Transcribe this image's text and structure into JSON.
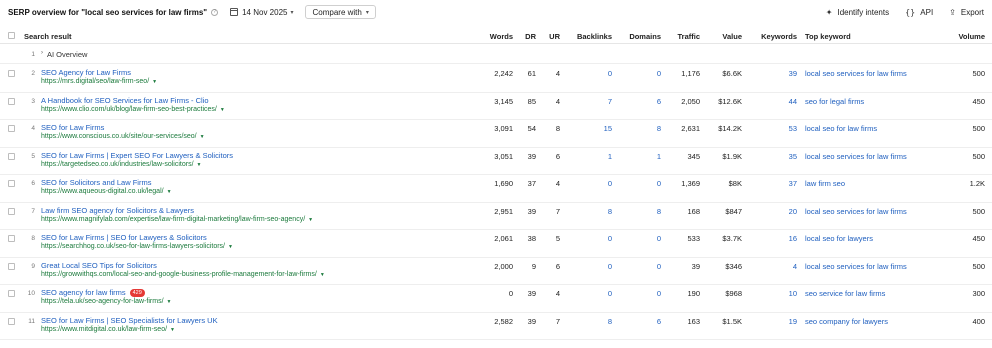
{
  "header": {
    "title": "SERP overview for \"local seo services for law firms\"",
    "date": "14 Nov 2025",
    "compare_label": "Compare with",
    "actions": [
      {
        "label": "Identify intents",
        "icon": "sparkle-icon"
      },
      {
        "label": "API",
        "icon": "braces-icon"
      },
      {
        "label": "Export",
        "icon": "export-icon"
      }
    ]
  },
  "table": {
    "columns": {
      "search_result": "Search result",
      "words": "Words",
      "dr": "DR",
      "ur": "UR",
      "backlinks": "Backlinks",
      "domains": "Domains",
      "traffic": "Traffic",
      "value": "Value",
      "keywords": "Keywords",
      "top_keyword": "Top keyword",
      "volume": "Volume"
    },
    "ai_overview": {
      "pos": "1",
      "label": "AI Overview"
    },
    "rows": [
      {
        "pos": "2",
        "title": "SEO Agency for Law Firms",
        "url": "https://mrs.digital/seo/law-firm-seo/",
        "badge": "",
        "words": "2,242",
        "dr": "61",
        "ur": "4",
        "backlinks": "0",
        "domains": "0",
        "traffic": "1,176",
        "value": "$6.6K",
        "keywords": "39",
        "top_keyword": "local seo services for law firms",
        "volume": "500"
      },
      {
        "pos": "3",
        "title": "A Handbook for SEO Services for Law Firms - Clio",
        "url": "https://www.clio.com/uk/blog/law-firm-seo-best-practices/",
        "badge": "",
        "words": "3,145",
        "dr": "85",
        "ur": "4",
        "backlinks": "7",
        "domains": "6",
        "traffic": "2,050",
        "value": "$12.6K",
        "keywords": "44",
        "top_keyword": "seo for legal firms",
        "volume": "450"
      },
      {
        "pos": "4",
        "title": "SEO for Law Firms",
        "url": "https://www.conscious.co.uk/site/our-services/seo/",
        "badge": "",
        "words": "3,091",
        "dr": "54",
        "ur": "8",
        "backlinks": "15",
        "domains": "8",
        "traffic": "2,631",
        "value": "$14.2K",
        "keywords": "53",
        "top_keyword": "local seo for law firms",
        "volume": "500"
      },
      {
        "pos": "5",
        "title": "SEO for Law Firms | Expert SEO For Lawyers & Solicitors",
        "url": "https://targetedseo.co.uk/industries/law-solicitors/",
        "badge": "",
        "words": "3,051",
        "dr": "39",
        "ur": "6",
        "backlinks": "1",
        "domains": "1",
        "traffic": "345",
        "value": "$1.9K",
        "keywords": "35",
        "top_keyword": "local seo services for law firms",
        "volume": "500"
      },
      {
        "pos": "6",
        "title": "SEO for Solicitors and Law Firms",
        "url": "https://www.aqueous-digital.co.uk/legal/",
        "badge": "",
        "words": "1,690",
        "dr": "37",
        "ur": "4",
        "backlinks": "0",
        "domains": "0",
        "traffic": "1,369",
        "value": "$8K",
        "keywords": "37",
        "top_keyword": "law firm seo",
        "volume": "1.2K"
      },
      {
        "pos": "7",
        "title": "Law firm SEO agency for Solicitors & Lawyers",
        "url": "https://www.magnifylab.com/expertise/law-firm-digital-marketing/law-firm-seo-agency/",
        "badge": "",
        "words": "2,951",
        "dr": "39",
        "ur": "7",
        "backlinks": "8",
        "domains": "8",
        "traffic": "168",
        "value": "$847",
        "keywords": "20",
        "top_keyword": "local seo services for law firms",
        "volume": "500"
      },
      {
        "pos": "8",
        "title": "SEO for Law Firms | SEO for Lawyers & Solicitors",
        "url": "https://searchhog.co.uk/seo-for-law-firms-lawyers-solicitors/",
        "badge": "",
        "words": "2,061",
        "dr": "38",
        "ur": "5",
        "backlinks": "0",
        "domains": "0",
        "traffic": "533",
        "value": "$3.7K",
        "keywords": "16",
        "top_keyword": "local seo for lawyers",
        "volume": "450"
      },
      {
        "pos": "9",
        "title": "Great Local SEO Tips for Solicitors",
        "url": "https://growwithqs.com/local-seo-and-google-business-profile-management-for-law-firms/",
        "badge": "",
        "words": "2,000",
        "dr": "9",
        "ur": "6",
        "backlinks": "0",
        "domains": "0",
        "traffic": "39",
        "value": "$346",
        "keywords": "4",
        "top_keyword": "local seo services for law firms",
        "volume": "500"
      },
      {
        "pos": "10",
        "title": "SEO agency for law firms",
        "url": "https://tela.uk/seo-agency-for-law-firms/",
        "badge": "429",
        "words": "0",
        "dr": "39",
        "ur": "4",
        "backlinks": "0",
        "domains": "0",
        "traffic": "190",
        "value": "$968",
        "keywords": "10",
        "top_keyword": "seo service for law firms",
        "volume": "300"
      },
      {
        "pos": "11",
        "title": "SEO for Law Firms | SEO Specialists for Lawyers UK",
        "url": "https://www.mitdigital.co.uk/law-firm-seo/",
        "badge": "",
        "words": "2,582",
        "dr": "39",
        "ur": "7",
        "backlinks": "8",
        "domains": "6",
        "traffic": "163",
        "value": "$1.5K",
        "keywords": "19",
        "top_keyword": "seo company for lawyers",
        "volume": "400"
      }
    ]
  },
  "colors": {
    "link": "#1f5fbf",
    "url": "#1b7a3c",
    "badge": "#e53935"
  }
}
